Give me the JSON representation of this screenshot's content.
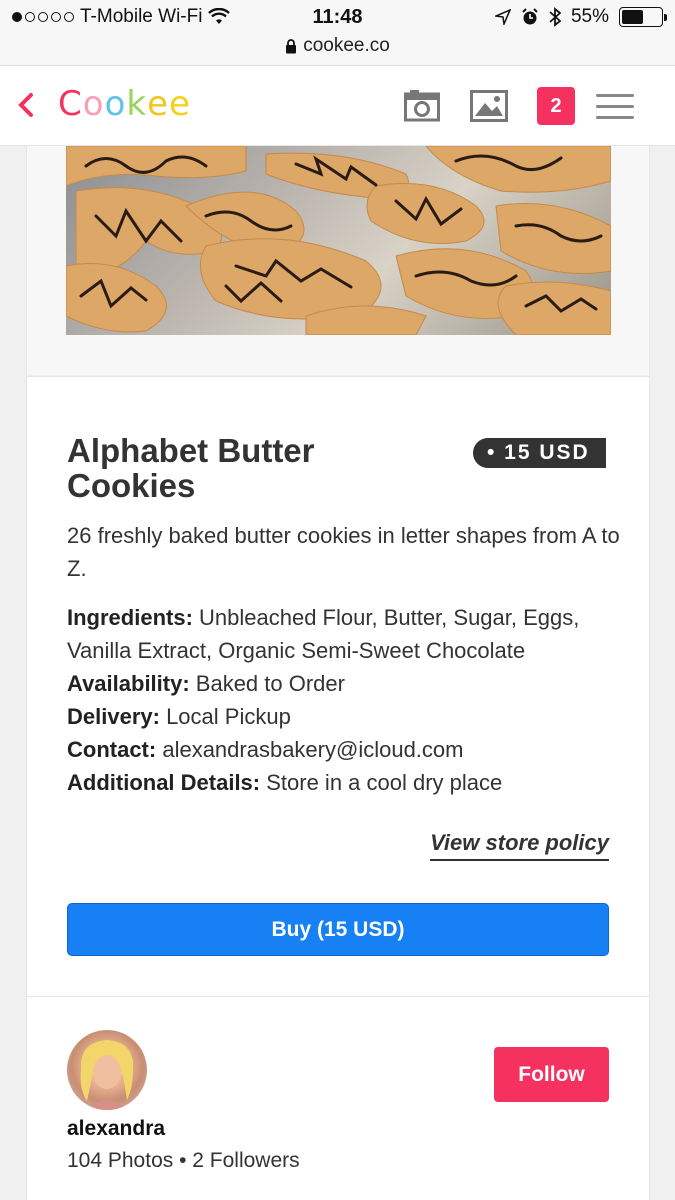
{
  "status_bar": {
    "carrier": "T-Mobile Wi-Fi",
    "time": "11:48",
    "battery": "55%",
    "battery_level": 0.55,
    "icons": [
      "signal-dots-icon",
      "wifi-icon",
      "location-arrow-icon",
      "alarm-icon",
      "bluetooth-icon",
      "battery-icon"
    ]
  },
  "url_bar": {
    "domain": "cookee.co",
    "icon": "lock-icon"
  },
  "nav": {
    "logo_letters": [
      "C",
      "o",
      "o",
      "k",
      "e",
      "e"
    ],
    "logo_colors": [
      "#f5325f",
      "#f7a0b5",
      "#5fc3e8",
      "#9ad45a",
      "#f4c51a",
      "#f4d21a"
    ],
    "notification_count": "2",
    "icons": [
      "back-chevron-icon",
      "camera-icon",
      "image-icon",
      "hamburger-menu-icon"
    ]
  },
  "product": {
    "title": "Alphabet Butter Cookies",
    "price_badge": "• 15 USD",
    "description": "26 freshly baked butter cookies in letter shapes from A to Z.",
    "details": [
      {
        "label": "Ingredients:",
        "value": " Unbleached Flour, Butter, Sugar, Eggs, Vanilla Extract, Organic Semi-Sweet Chocolate"
      },
      {
        "label": "Availability:",
        "value": " Baked to Order"
      },
      {
        "label": "Delivery:",
        "value": " Local Pickup"
      },
      {
        "label": "Contact:",
        "value": " alexandrasbakery@icloud.com"
      },
      {
        "label": "Additional Details:",
        "value": " Store in a cool dry place"
      }
    ],
    "policy_link": "View store policy",
    "buy_button": "Buy (15 USD)"
  },
  "seller": {
    "name": "alexandra",
    "stats": "104 Photos • 2 Followers",
    "follow_button": "Follow"
  },
  "colors": {
    "accent": "#f5325f",
    "buy_blue": "#1880f5",
    "price_badge_bg": "#333333"
  }
}
